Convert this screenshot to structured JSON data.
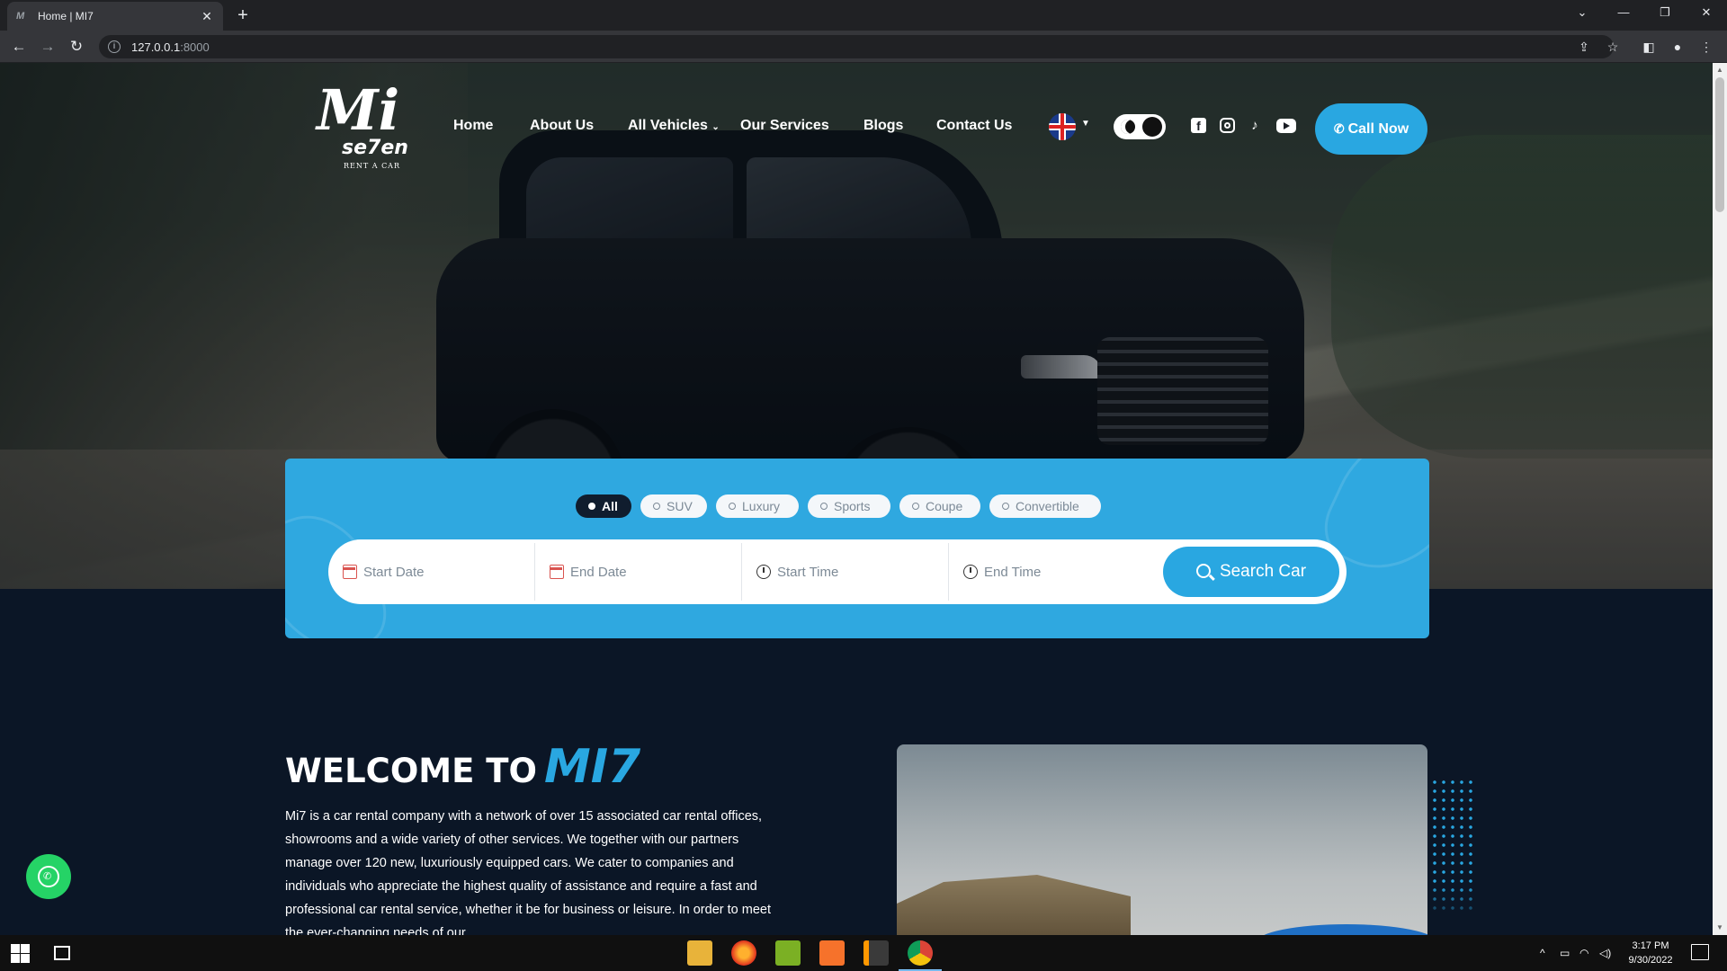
{
  "browser": {
    "tab_title": "Home | MI7",
    "url_host": "127.0.0.1",
    "url_port": ":8000"
  },
  "site": {
    "logo": {
      "script": "Mi",
      "seven": "se7en",
      "tagline": "RENT A CAR"
    },
    "nav": [
      {
        "label": "Home"
      },
      {
        "label": "About Us"
      },
      {
        "label": "All Vehicles"
      },
      {
        "label": "Our Services"
      },
      {
        "label": "Blogs"
      },
      {
        "label": "Contact Us"
      }
    ],
    "call_label": "Call Now",
    "social": [
      "facebook-icon",
      "instagram-icon",
      "tiktok-icon",
      "youtube-icon"
    ]
  },
  "search": {
    "filters": [
      {
        "label": "All",
        "active": true
      },
      {
        "label": "SUV"
      },
      {
        "label": "Luxury"
      },
      {
        "label": "Sports"
      },
      {
        "label": "Coupe"
      },
      {
        "label": "Convertible"
      }
    ],
    "start_date": "Start Date",
    "end_date": "End Date",
    "start_time": "Start Time",
    "end_time": "End Time",
    "button": "Search Car"
  },
  "welcome": {
    "title_prefix": "WELCOME TO",
    "title_brand": "MI7",
    "text": "Mi7 is a car rental company with a network of over 15 associated car rental offices, showrooms and a wide variety of other services. We together with our partners manage over 120 new, luxuriously equipped cars. We cater to companies and individuals who appreciate the highest quality of assistance and require a fast and professional car rental service, whether it be for business or leisure. In order to meet the ever-changing needs of our"
  },
  "taskbar": {
    "time": "3:17 PM",
    "date": "9/30/2022"
  },
  "colors": {
    "accent": "#29a7e1",
    "page_bg": "#0b1626",
    "whatsapp": "#25d366"
  }
}
